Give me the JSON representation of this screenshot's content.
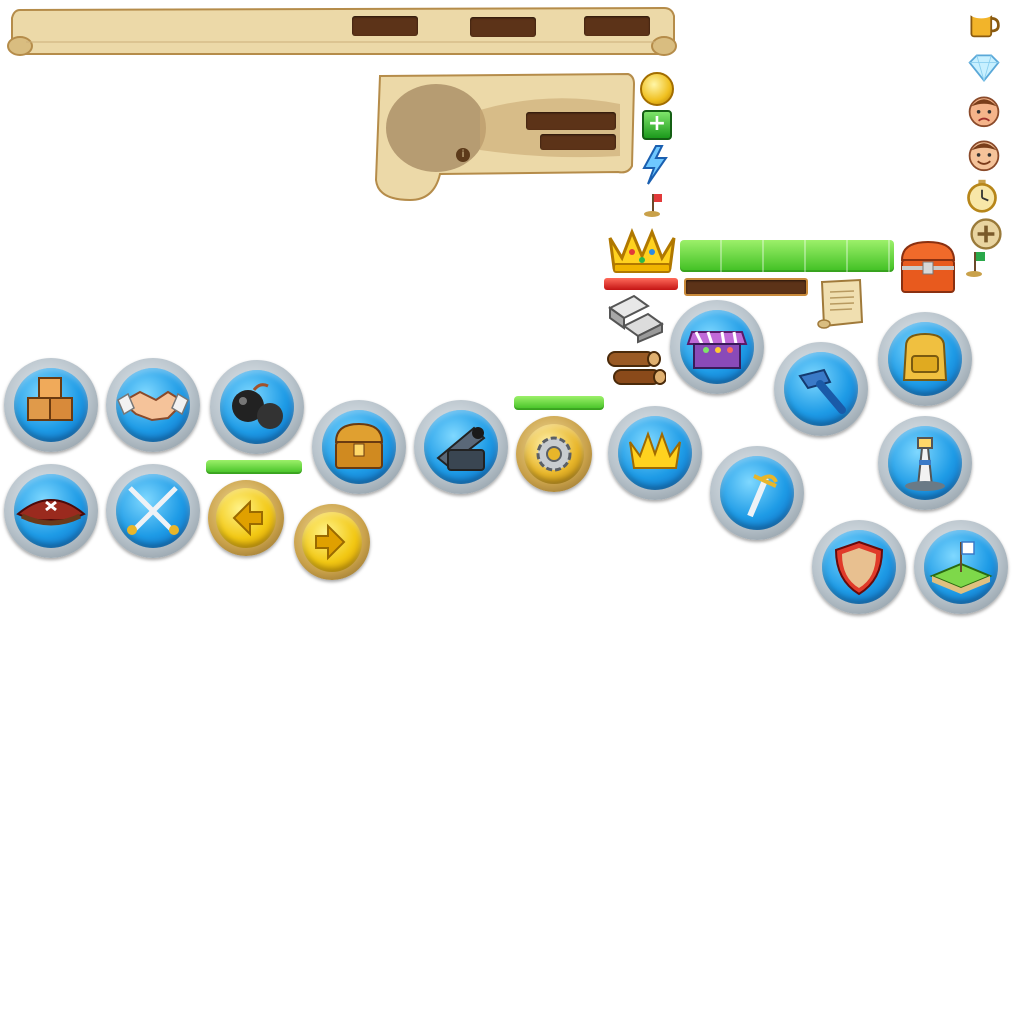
{
  "screen": "game-ui-sprite-sheet",
  "colors": {
    "parchment": "#ecd9a8",
    "parchment_edge": "#b58c4a",
    "slot": "#5c3318",
    "button_blue": "#1e9be6",
    "button_rim": "#b9c4cc",
    "gold": "#f2c814",
    "progress_green": "#4fd02a",
    "health_red": "#d81e1e"
  },
  "top_scroll": {
    "slots": 3
  },
  "info_panel": {
    "slots": 2,
    "info_icon": "info-icon"
  },
  "resource_icons": [
    "coin-icon",
    "add-icon",
    "energy-icon",
    "flag-icon"
  ],
  "side_icons": [
    "beer-icon",
    "diamond-icon",
    "sad-face-icon",
    "happy-face-icon",
    "stopwatch-icon",
    "plus-icon",
    "flag-icon"
  ],
  "crown_panel": {
    "icon": "crown-icon",
    "xp_progress": 1.0,
    "health_progress": 1.0,
    "chest_icon": "treasure-chest-icon",
    "scroll_icon": "scroll-icon"
  },
  "material_icons": [
    "silver-bars-icon",
    "wood-logs-icon"
  ],
  "buttons": [
    {
      "name": "crates-button",
      "icon": "crates-icon"
    },
    {
      "name": "trade-button",
      "icon": "handshake-icon"
    },
    {
      "name": "bombs-button",
      "icon": "bombs-icon"
    },
    {
      "name": "treasure-button",
      "icon": "treasure-chest-icon"
    },
    {
      "name": "cannon-button",
      "icon": "cannon-icon"
    },
    {
      "name": "settings-button",
      "icon": "gear-icon"
    },
    {
      "name": "crown-button",
      "icon": "crown-icon"
    },
    {
      "name": "market-button",
      "icon": "market-stall-icon"
    },
    {
      "name": "build-button",
      "icon": "hammer-icon"
    },
    {
      "name": "backpack-button",
      "icon": "backpack-icon"
    },
    {
      "name": "pirate-hat-button",
      "icon": "pirate-hat-icon"
    },
    {
      "name": "battle-button",
      "icon": "crossed-swords-icon"
    },
    {
      "name": "previous-button",
      "icon": "arrow-left-icon"
    },
    {
      "name": "next-button",
      "icon": "arrow-right-icon"
    },
    {
      "name": "sword-button",
      "icon": "sword-icon"
    },
    {
      "name": "lighthouse-button",
      "icon": "lighthouse-icon"
    },
    {
      "name": "defense-button",
      "icon": "shield-icon"
    },
    {
      "name": "territory-button",
      "icon": "island-flag-icon"
    }
  ],
  "progress_bars": {
    "green_small_1": 1.0,
    "green_small_2": 1.0
  }
}
